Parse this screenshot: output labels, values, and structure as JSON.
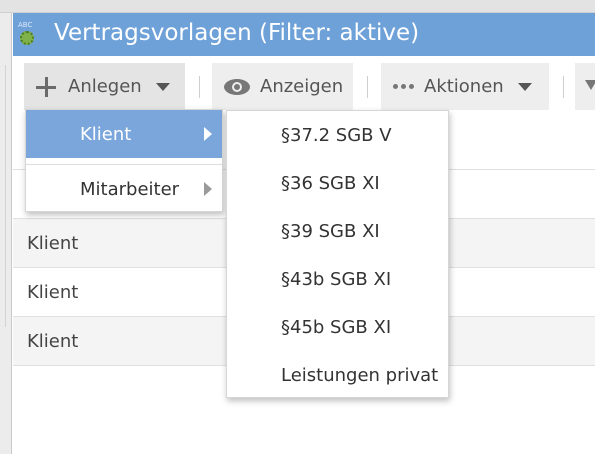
{
  "window": {
    "title": "Vertragsvorlagen (Filter: aktive)",
    "icon_text": "ABC",
    "icons": {
      "app": "gear-document-icon"
    },
    "colors": {
      "titlebar": "#6fa1d9",
      "selection": "#7aa6db"
    }
  },
  "toolbar": {
    "create_label": "Anlegen",
    "view_label": "Anzeigen",
    "actions_label": "Aktionen",
    "icons": {
      "create": "plus-icon",
      "view": "eye-icon",
      "actions": "ellipsis-icon",
      "dropdown": "caret-down-icon",
      "filter": "filter-icon"
    }
  },
  "list": {
    "rows": [
      "Klient",
      "Klient",
      "Klient"
    ]
  },
  "create_menu": {
    "items": [
      {
        "label": "Klient",
        "selected": true
      },
      {
        "label": "Mitarbeiter",
        "selected": false
      }
    ]
  },
  "client_submenu": {
    "items": [
      "§37.2 SGB V",
      "§36 SGB XI",
      "§39 SGB XI",
      "§43b SGB XI",
      "§45b SGB XI",
      "Leistungen privat"
    ]
  }
}
